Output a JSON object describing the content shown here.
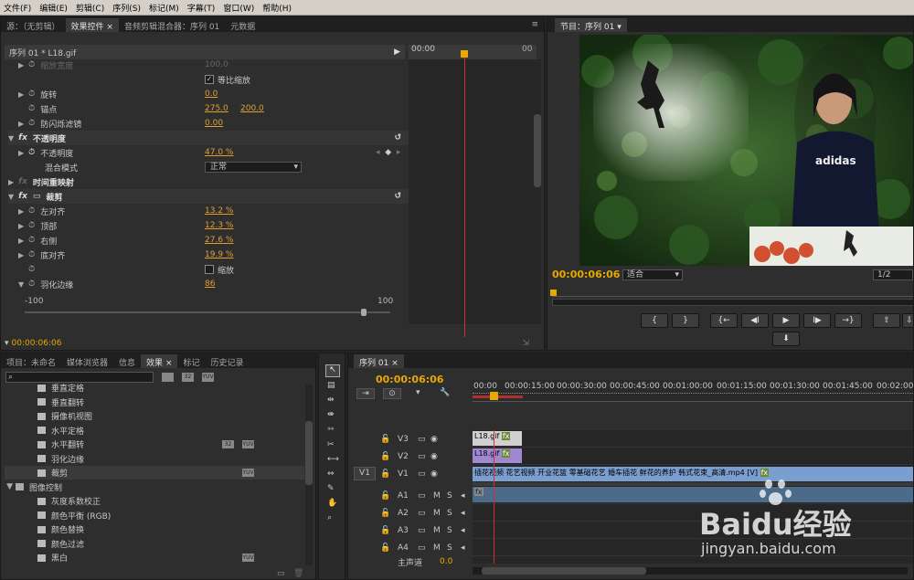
{
  "menu": [
    "文件(F)",
    "编辑(E)",
    "剪辑(C)",
    "序列(S)",
    "标记(M)",
    "字幕(T)",
    "窗口(W)",
    "帮助(H)"
  ],
  "source_tabs": [
    "源：（无剪辑）",
    "效果控件",
    "音频剪辑混合器：序列 01",
    "元数据"
  ],
  "effect_controls": {
    "header": "序列 01 * L18.gif",
    "ruler_time": "00:00",
    "rows": {
      "scale_width": "缩放宽度",
      "scale_width_val": "100.0",
      "uniform_scale": "等比缩放",
      "rotation": "旋转",
      "rotation_val": "0.0",
      "anchor": "锚点",
      "anchor_x": "275.0",
      "anchor_y": "200.0",
      "antiflicker": "防闪烁滤镜",
      "antiflicker_val": "0.00",
      "opacity_section": "不透明度",
      "opacity": "不透明度",
      "opacity_val": "47.0 %",
      "blend_mode": "混合模式",
      "blend_val": "正常",
      "time_remap": "时间重映射",
      "crop": "裁剪",
      "left": "左对齐",
      "left_val": "13.2 %",
      "top": "顶部",
      "top_val": "12.3 %",
      "right": "右侧",
      "right_val": "27.6 %",
      "bottom": "底对齐",
      "bottom_val": "19.9 %",
      "zoom": "缩放",
      "feather": "羽化边缘",
      "feather_val": "86",
      "slider_min": "-100",
      "slider_max": "100"
    },
    "footer_time": "00:00:06:06"
  },
  "program": {
    "tab": "节目：序列 01",
    "timecode": "00:00:06:06",
    "fit": "适合",
    "resolution": "1/2",
    "brand_text": "adidas"
  },
  "project_tabs": [
    "项目：未命名",
    "媒体浏览器",
    "信息",
    "效果",
    "标记",
    "历史记录"
  ],
  "effects_list": [
    {
      "label": "垂直定格",
      "indent": 1,
      "badges": []
    },
    {
      "label": "垂直翻转",
      "indent": 1,
      "badges": []
    },
    {
      "label": "摄像机视图",
      "indent": 1,
      "badges": []
    },
    {
      "label": "水平定格",
      "indent": 1,
      "badges": []
    },
    {
      "label": "水平翻转",
      "indent": 1,
      "badges": [
        "32",
        "YUV"
      ]
    },
    {
      "label": "羽化边缘",
      "indent": 1,
      "badges": []
    },
    {
      "label": "裁剪",
      "indent": 1,
      "badges": [
        "YUV"
      ],
      "selected": true
    },
    {
      "label": "图像控制",
      "indent": 0,
      "folder": true,
      "badges": []
    },
    {
      "label": "灰度系数校正",
      "indent": 1,
      "badges": []
    },
    {
      "label": "颜色平衡 (RGB)",
      "indent": 1,
      "badges": []
    },
    {
      "label": "颜色替换",
      "indent": 1,
      "badges": []
    },
    {
      "label": "颜色过滤",
      "indent": 1,
      "badges": []
    },
    {
      "label": "黑白",
      "indent": 1,
      "badges": [
        "YUV"
      ]
    }
  ],
  "sequence": {
    "tab": "序列 01",
    "timecode": "00:00:06:06",
    "ruler": [
      "00:00",
      "00:00:15:00",
      "00:00:30:00",
      "00:00:45:00",
      "00:01:00:00",
      "00:01:15:00",
      "00:01:30:00",
      "00:01:45:00",
      "00:02:00"
    ],
    "tracks": [
      "V3",
      "V2",
      "V1",
      "A1",
      "A2",
      "A3",
      "A4"
    ],
    "source_patch": "V1",
    "master": "主声道",
    "master_val": "0.0",
    "clip_v3": "L18.gif",
    "clip_v2": "L18.gif",
    "clip_v1": "插花视频 花艺视频 开业花篮 零基础花艺 婚车插花 鲜花的养护 韩式花束_高清.mp4 [V]"
  },
  "watermark": {
    "line1": "Baidu经验",
    "line2": "jingyan.baidu.com"
  }
}
